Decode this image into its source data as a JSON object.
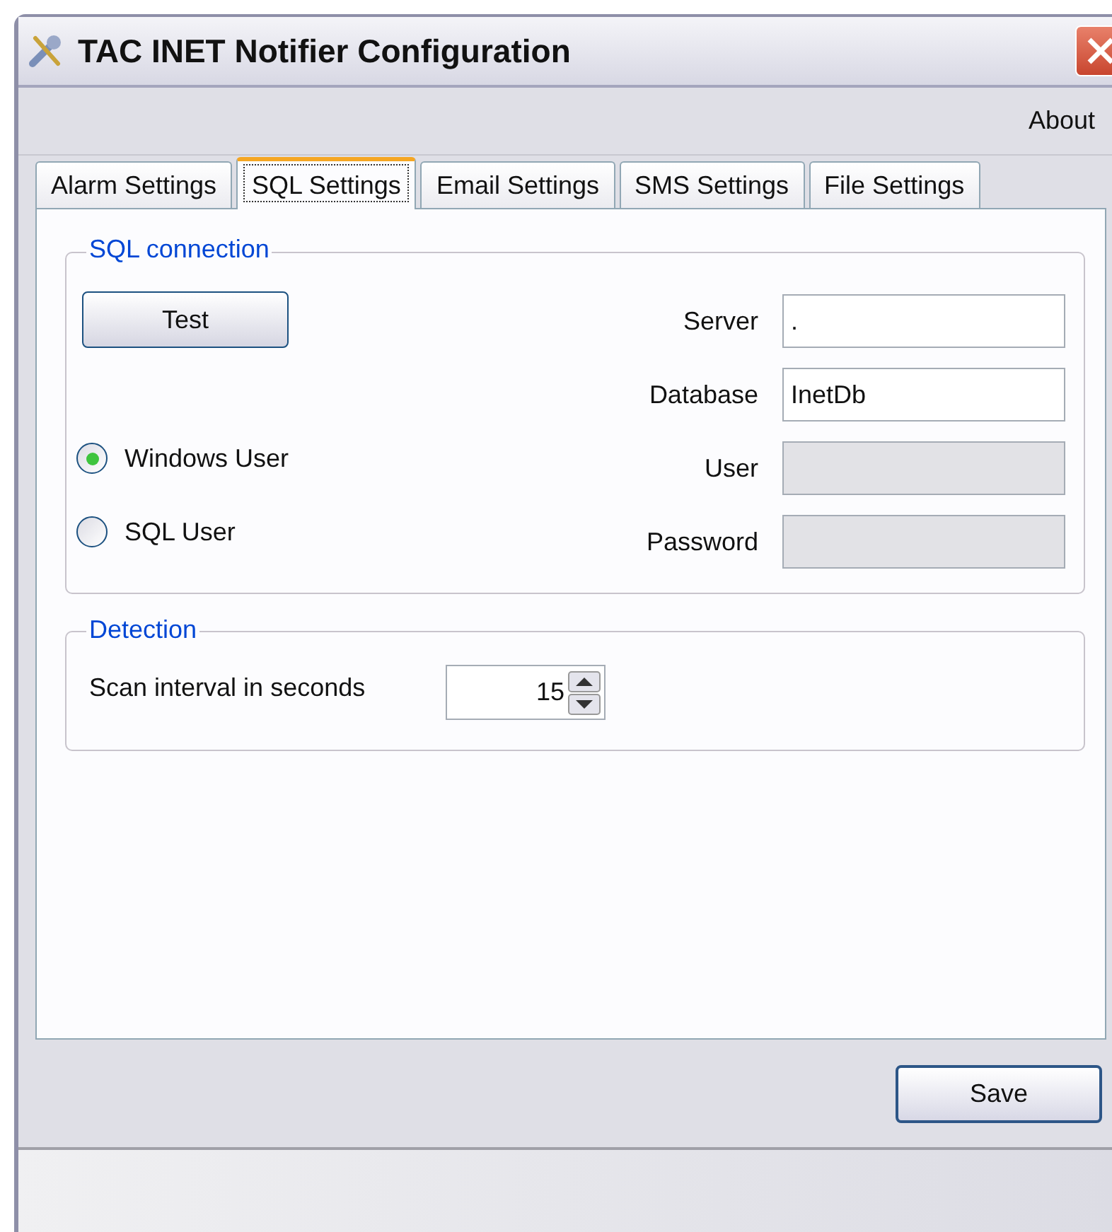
{
  "window": {
    "title": "TAC INET Notifier Configuration"
  },
  "menu": [
    "About"
  ],
  "tabs": [
    {
      "label": "Alarm Settings",
      "selected": false
    },
    {
      "label": "SQL Settings",
      "selected": true
    },
    {
      "label": "Email Settings",
      "selected": false
    },
    {
      "label": "SMS Settings",
      "selected": false
    },
    {
      "label": "File Settings",
      "selected": false
    }
  ],
  "sql_connection": {
    "title": "SQL connection",
    "test_button": "Test",
    "auth": [
      {
        "label": "Windows User",
        "selected": true
      },
      {
        "label": "SQL User",
        "selected": false
      }
    ],
    "fields": [
      {
        "label": "Server",
        "value": ".",
        "disabled": false
      },
      {
        "label": "Database",
        "value": "InetDb",
        "disabled": false
      },
      {
        "label": "User",
        "disabled": true
      },
      {
        "label": "Password",
        "disabled": true
      }
    ]
  },
  "detection": {
    "title": "Detection",
    "scan_label": "Scan interval in seconds",
    "scan_value": "15"
  },
  "save_button": "Save"
}
